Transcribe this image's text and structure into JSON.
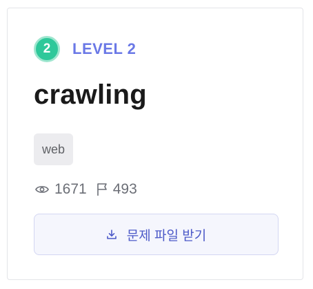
{
  "problem": {
    "level_number": "2",
    "level_label": "LEVEL 2",
    "title": "crawling",
    "tag": "web",
    "views": "1671",
    "solves": "493",
    "download_label": "문제 파일 받기"
  },
  "colors": {
    "level_badge": "#2ec89a",
    "level_text": "#6a78e6",
    "button_text": "#4c59c8",
    "button_bg": "#f5f6fd",
    "tag_bg": "#ececef"
  },
  "icons": {
    "views": "eye-icon",
    "solves": "flag-icon",
    "download": "download-icon"
  }
}
